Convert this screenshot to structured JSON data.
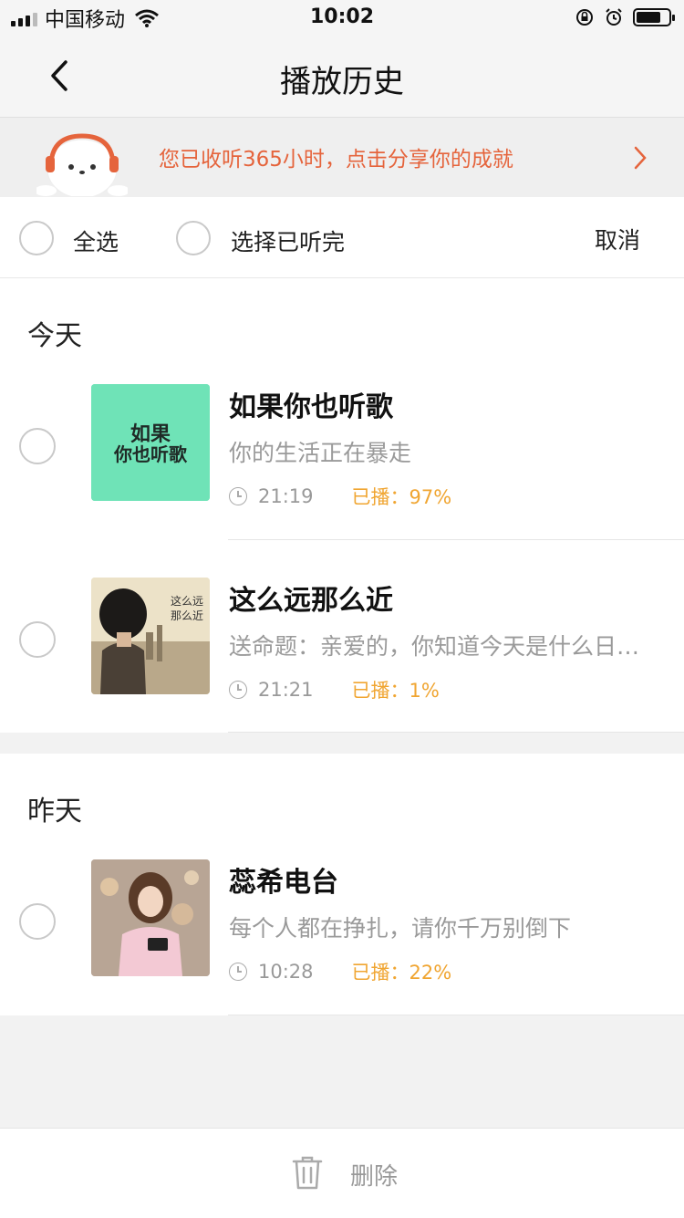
{
  "status_bar": {
    "carrier": "中国移动",
    "time": "10:02"
  },
  "nav": {
    "title": "播放历史",
    "back_icon": "chevron-left-icon"
  },
  "banner": {
    "text": "您已收听365小时，点击分享你的成就",
    "color": "#e5643c"
  },
  "select_bar": {
    "select_all": "全选",
    "select_finished": "选择已听完",
    "cancel": "取消"
  },
  "sections": [
    {
      "title": "今天",
      "items": [
        {
          "title": "如果你也听歌",
          "subtitle": "你的生活正在暴走",
          "time": "21:19",
          "played": "已播：97%",
          "cover_text": "如果你也听歌"
        },
        {
          "title": "这么远那么近",
          "subtitle": "送命题：亲爱的，你知道今天是什么日子吗？",
          "time": "21:21",
          "played": "已播：1%",
          "cover_text": "这么远那么近"
        }
      ]
    },
    {
      "title": "昨天",
      "items": [
        {
          "title": "蕊希电台",
          "subtitle": "每个人都在挣扎，请你千万别倒下",
          "time": "10:28",
          "played": "已播：22%"
        }
      ]
    }
  ],
  "bottom": {
    "delete_label": "删除",
    "delete_icon": "trash-icon"
  },
  "colors": {
    "accent_orange": "#e5643c",
    "played_color": "#f0a531"
  }
}
